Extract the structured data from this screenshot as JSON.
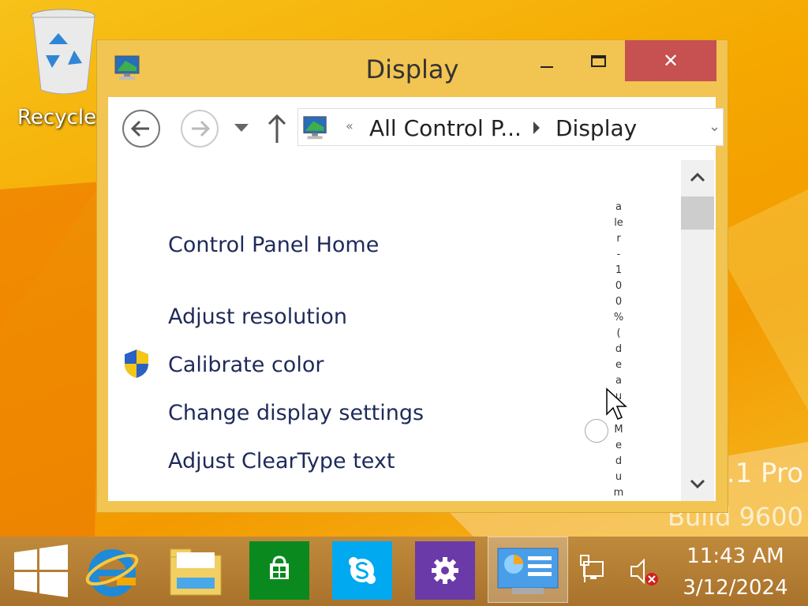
{
  "desktop": {
    "recycle_bin_label": "Recycle",
    "watermark_line1": ".1 Pro",
    "watermark_line2": "Build 9600"
  },
  "window": {
    "title": "Display",
    "close_glyph": "✕",
    "navigation": {
      "address_chevron": "«",
      "breadcrumb": [
        "All Control P...",
        "Display"
      ],
      "address_dropdown_glyph": "⌄"
    },
    "task_links": {
      "home": "Control Panel Home",
      "items": [
        "Adjust resolution",
        "Calibrate color",
        "Change display settings",
        "Adjust ClearType text"
      ]
    },
    "content_fragments": {
      "column1": "a\nle\nr\n-\n1\n0\n0\n%\n(\nd\ne\na\nu",
      "column2": "M\ne\nd\nu\nm"
    }
  },
  "taskbar": {
    "pinned": [
      "Start",
      "Internet Explorer",
      "File Explorer",
      "Store",
      "Skype",
      "PC settings",
      "Control Panel"
    ],
    "clock_time": "11:43 AM",
    "clock_date": "3/12/2024"
  },
  "colors": {
    "window_frame": "#f2c451",
    "close_button": "#c75050",
    "link_text": "#1e2a5a",
    "taskbar": "#b07830"
  }
}
